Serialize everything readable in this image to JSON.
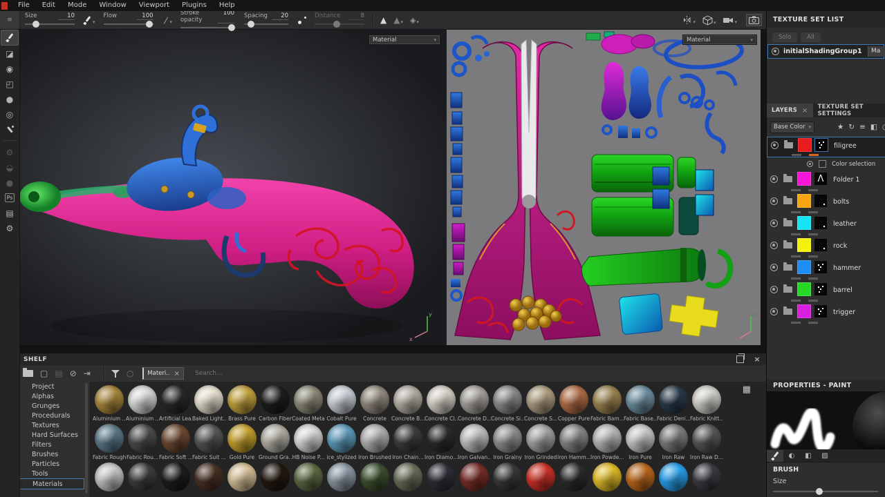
{
  "menu": {
    "items": [
      "File",
      "Edit",
      "Mode",
      "Window",
      "Viewport",
      "Plugins",
      "Help"
    ]
  },
  "tool_options": {
    "size": {
      "label": "Size",
      "value": "10",
      "pct": 22
    },
    "flow": {
      "label": "Flow",
      "value": "100",
      "pct": 92
    },
    "stroke_opacity": {
      "label": "Stroke opacity",
      "value": "100",
      "pct": 95
    },
    "spacing": {
      "label": "Spacing",
      "value": "20",
      "pct": 15
    },
    "distance": {
      "label": "Distance",
      "value": "8",
      "pct": 45
    }
  },
  "viewports": {
    "material_3d": "Material",
    "material_2d": "Material"
  },
  "texture_set_list": {
    "title": "TEXTURE SET LIST",
    "solo_label": "Solo",
    "all_label": "All",
    "set_name": "initialShadingGroup1",
    "badge": "Ma"
  },
  "layers_panel": {
    "tab_layers": "LAYERS",
    "tab_close": "×",
    "tab_settings": "TEXTURE SET SETTINGS",
    "channel": "Base Color",
    "layers": [
      {
        "name": "filigree",
        "color": "#e81c1c",
        "mask": "marks",
        "selected": true,
        "bar": "#d2691e",
        "sub": {
          "label": "Color selection"
        }
      },
      {
        "name": "Folder 1",
        "color": "#f516d8",
        "mask": "lambda"
      },
      {
        "name": "bolts",
        "color": "#f7a511",
        "mask": "dot"
      },
      {
        "name": "leather",
        "color": "#16e3f5",
        "mask": "dot"
      },
      {
        "name": "rock",
        "color": "#f2f20c",
        "mask": "dot"
      },
      {
        "name": "hammer",
        "color": "#1f8ef2",
        "mask": "marks"
      },
      {
        "name": "barrel",
        "color": "#26d926",
        "mask": "marks"
      },
      {
        "name": "trigger",
        "color": "#da1ede",
        "mask": "marks"
      }
    ]
  },
  "properties": {
    "title": "PROPERTIES - PAINT",
    "brush_section": "BRUSH",
    "size_label": "Size",
    "size_pct": 44
  },
  "shelf": {
    "title": "SHELF",
    "filter_tag": "Materi..",
    "search_placeholder": "Search...",
    "categories": [
      "Project",
      "Alphas",
      "Grunges",
      "Procedurals",
      "Textures",
      "Hard Surfaces",
      "Filters",
      "Brushes",
      "Particles",
      "Tools",
      "Materials"
    ],
    "selected_category": "Materials",
    "material_rows": [
      [
        {
          "label": "Aluminium ...",
          "color": "#ab8a3d"
        },
        {
          "label": "Aluminium ...",
          "color": "#dcdcdc"
        },
        {
          "label": "Artificial Lea...",
          "color": "#2b2b2b"
        },
        {
          "label": "Baked Light...",
          "color": "#eae3d2"
        },
        {
          "label": "Brass Pure",
          "color": "#c6a53e"
        },
        {
          "label": "Carbon Fiber",
          "color": "#1f1f1f"
        },
        {
          "label": "Coated Metal",
          "color": "#8f8d7a"
        },
        {
          "label": "Cobalt Pure",
          "color": "#ccd3da"
        },
        {
          "label": "Concrete",
          "color": "#968e82"
        },
        {
          "label": "Concrete B...",
          "color": "#b8b1a6"
        },
        {
          "label": "Concrete Cl...",
          "color": "#dad5cb"
        },
        {
          "label": "Concrete D...",
          "color": "#a9a59e"
        },
        {
          "label": "Concrete Si...",
          "color": "#8e8e8e"
        },
        {
          "label": "Concrete S...",
          "color": "#b2a084"
        },
        {
          "label": "Copper Pure",
          "color": "#b46f48"
        },
        {
          "label": "Fabric Bam...",
          "color": "#9f8752"
        },
        {
          "label": "Fabric Base...",
          "color": "#6f92a4"
        },
        {
          "label": "Fabric Deni...",
          "color": "#2c3c4c"
        },
        {
          "label": "Fabric Knitt...",
          "color": "#d6d4ce"
        }
      ],
      [
        {
          "label": "Fabric Rough",
          "color": "#5e7d8c"
        },
        {
          "label": "Fabric Rou...",
          "color": "#4f4f4f"
        },
        {
          "label": "Fabric Soft ...",
          "color": "#6f4b33"
        },
        {
          "label": "Fabric Suit ...",
          "color": "#585858"
        },
        {
          "label": "Gold Pure",
          "color": "#caa42f"
        },
        {
          "label": "Ground Gra...",
          "color": "#b5b3a8"
        },
        {
          "label": "HB Noise P...",
          "color": "#dcdcdc"
        },
        {
          "label": "ice_stylized",
          "color": "#5fa0c0"
        },
        {
          "label": "Iron Brushed",
          "color": "#b5b5b5"
        },
        {
          "label": "Iron Chain...",
          "color": "#3f3f3f"
        },
        {
          "label": "Iron Diamo...",
          "color": "#2d2d2d"
        },
        {
          "label": "Iron Galvan...",
          "color": "#c4c4c4"
        },
        {
          "label": "Iron Grainy",
          "color": "#949494"
        },
        {
          "label": "Iron Grinded",
          "color": "#a6a6a6"
        },
        {
          "label": "Iron Hamm...",
          "color": "#8a8a8a"
        },
        {
          "label": "Iron Powde...",
          "color": "#bcbcbc"
        },
        {
          "label": "Iron Pure",
          "color": "#cccccc"
        },
        {
          "label": "Iron Raw",
          "color": "#808080"
        },
        {
          "label": "Iron Raw D...",
          "color": "#5a5a5a"
        }
      ],
      [
        {
          "label": "",
          "color": "#c9c9c9"
        },
        {
          "label": "",
          "color": "#3f3f3f"
        },
        {
          "label": "",
          "color": "#1e1e1e"
        },
        {
          "label": "",
          "color": "#4a3325"
        },
        {
          "label": "",
          "color": "#d9c49a"
        },
        {
          "label": "",
          "color": "#241a12"
        },
        {
          "label": "",
          "color": "#5f6b45"
        },
        {
          "label": "",
          "color": "#8d9aa5"
        },
        {
          "label": "",
          "color": "#3e5231"
        },
        {
          "label": "",
          "color": "#6b705a"
        },
        {
          "label": "",
          "color": "#30303a"
        },
        {
          "label": "",
          "color": "#7a2f28"
        },
        {
          "label": "",
          "color": "#3a3a3a"
        },
        {
          "label": "",
          "color": "#d03227"
        },
        {
          "label": "",
          "color": "#2e2e2e"
        },
        {
          "label": "",
          "color": "#e5c029"
        },
        {
          "label": "",
          "color": "#c06a1d"
        },
        {
          "label": "",
          "color": "#2aa3ef"
        },
        {
          "label": "",
          "color": "#3c3c44"
        }
      ]
    ]
  },
  "glyphs": {
    "chevron": "▾",
    "grip": "≡",
    "close": "×",
    "tri_solid": "▲",
    "stamp": "◈",
    "eraser": "◪",
    "projection": "◉",
    "polyfill": "◰",
    "smudge": "●",
    "clone": "◎",
    "gear": "⚙",
    "bell": "◒",
    "doc": "▤",
    "ps": "Ps",
    "wand": "★",
    "refresh": "↻",
    "addlayer": "≡",
    "fill": "◧",
    "partial": "◔",
    "newdoc": "▢",
    "save": "▤",
    "eyeoff": "⊘",
    "import": "⇥",
    "circle": "○",
    "grid": "▦",
    "sphere_tab": "◐",
    "half_tab": "◧",
    "grad_tab": "▨"
  }
}
